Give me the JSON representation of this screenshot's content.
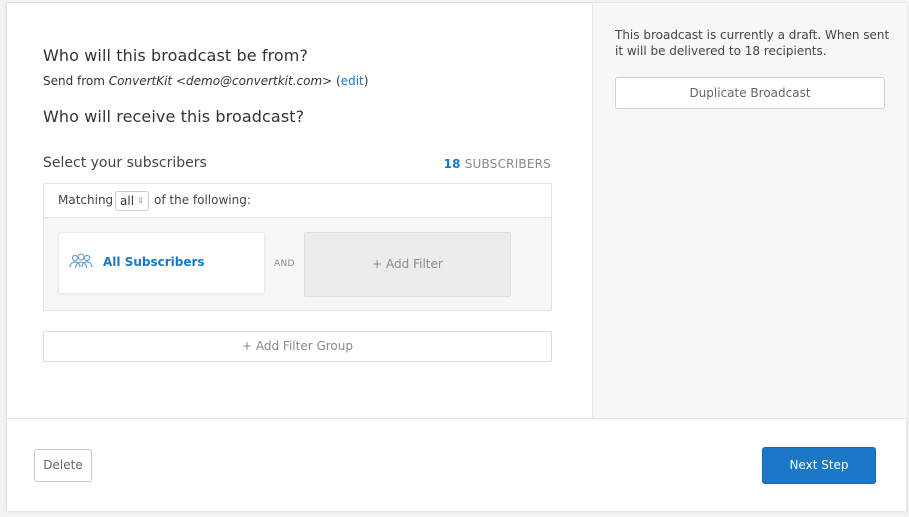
{
  "sender": {
    "question": "Who will this broadcast be from?",
    "prefix": "Send from ",
    "name": "ConvertKit",
    "email": " <demo@convertkit.com>",
    "paren_open": " (",
    "edit_label": "edit",
    "paren_close": ")"
  },
  "recipients": {
    "question": "Who will receive this broadcast?",
    "select_label": "Select your subscribers",
    "count": "18",
    "count_label": " SUBSCRIBERS",
    "matching_prefix": "Matching",
    "matching_value": "all",
    "matching_suffix": "of the following:",
    "filters": {
      "all_subscribers_label": "All Subscribers",
      "all_subscribers_icon": "users-icon",
      "and_label": "AND",
      "add_filter_label": "+ Add Filter"
    },
    "add_filter_group_label": "+ Add Filter Group"
  },
  "sidebar": {
    "status_text": "This broadcast is currently a draft. When sent it will be delivered to 18 recipients.",
    "duplicate_label": "Duplicate Broadcast"
  },
  "footer": {
    "delete_label": "Delete",
    "next_label": "Next Step"
  },
  "colors": {
    "accent": "#1a78c6",
    "link": "#1a78c2",
    "panel_bg": "#f7f7f7"
  }
}
